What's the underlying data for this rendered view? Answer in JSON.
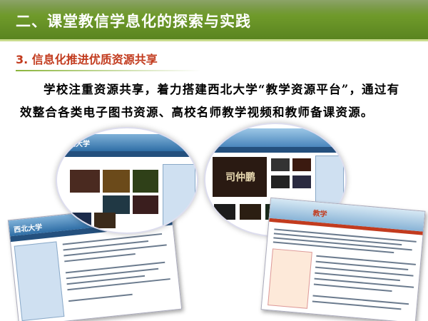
{
  "slide": {
    "title": "二、课堂教信学息化的探索与实践",
    "subtitle": "3. 信息化推进优质资源共享",
    "paragraph": "学校注重资源共享，着力搭建西北大学“教学资源平台”，通过有效整合各类电子图书资源、高校名师教学视频和教师备课资源。"
  },
  "colors": {
    "title_bar": "#5f8a22",
    "subtitle": "#c23b1e",
    "site_header": "#2f6ea6"
  },
  "screenshots": {
    "left_circle_logo": "西北大学",
    "right_circle_video_caption": "司仲鹏",
    "bottom_left_logo": "西北大学",
    "bottom_right_header": "教学"
  }
}
